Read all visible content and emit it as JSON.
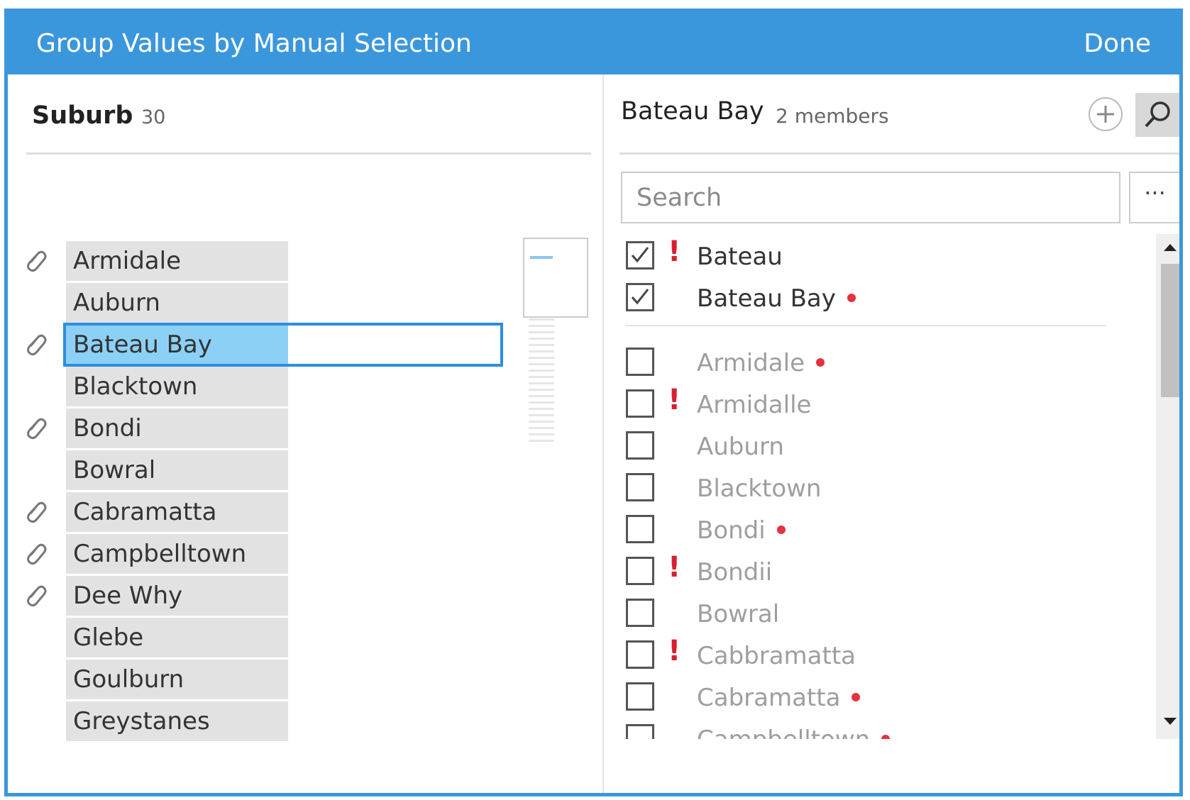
{
  "dialog": {
    "title": "Group Values by Manual Selection",
    "done_label": "Done"
  },
  "left": {
    "field_name": "Suburb",
    "field_count": "30",
    "groups": [
      {
        "label": "Armidale",
        "grouped": true
      },
      {
        "label": "Auburn",
        "grouped": false
      },
      {
        "label": "Bateau Bay",
        "grouped": true,
        "selected": true
      },
      {
        "label": "Blacktown",
        "grouped": false
      },
      {
        "label": "Bondi",
        "grouped": true
      },
      {
        "label": "Bowral",
        "grouped": false
      },
      {
        "label": "Cabramatta",
        "grouped": true
      },
      {
        "label": "Campbelltown",
        "grouped": true
      },
      {
        "label": "Dee Why",
        "grouped": true
      },
      {
        "label": "Glebe",
        "grouped": false
      },
      {
        "label": "Goulburn",
        "grouped": false
      },
      {
        "label": "Greystanes",
        "grouped": false
      }
    ]
  },
  "right": {
    "group_name": "Bateau Bay",
    "member_count": "2 members",
    "search_placeholder": "Search",
    "more_label": "···",
    "members": [
      {
        "label": "Bateau",
        "checked": true,
        "warning": true,
        "dot": false
      },
      {
        "label": "Bateau Bay",
        "checked": true,
        "warning": false,
        "dot": true
      }
    ],
    "others": [
      {
        "label": "Armidale",
        "checked": false,
        "warning": false,
        "dot": true
      },
      {
        "label": "Armidalle",
        "checked": false,
        "warning": true,
        "dot": false
      },
      {
        "label": "Auburn",
        "checked": false,
        "warning": false,
        "dot": false
      },
      {
        "label": "Blacktown",
        "checked": false,
        "warning": false,
        "dot": false
      },
      {
        "label": "Bondi",
        "checked": false,
        "warning": false,
        "dot": true
      },
      {
        "label": "Bondii",
        "checked": false,
        "warning": true,
        "dot": false
      },
      {
        "label": "Bowral",
        "checked": false,
        "warning": false,
        "dot": false
      },
      {
        "label": "Cabbramatta",
        "checked": false,
        "warning": true,
        "dot": false
      },
      {
        "label": "Cabramatta",
        "checked": false,
        "warning": false,
        "dot": true
      },
      {
        "label": "Campbelltown",
        "checked": false,
        "warning": false,
        "dot": true
      }
    ]
  },
  "colors": {
    "accent": "#3b97dc",
    "selected_fill": "#8dd0f6",
    "warning": "#d6202f",
    "dot": "#e4323f"
  },
  "icons": {
    "grouped": "paperclip-icon",
    "add": "plus-circle-icon",
    "search": "magnifier-icon",
    "warning": "exclamation-icon"
  }
}
